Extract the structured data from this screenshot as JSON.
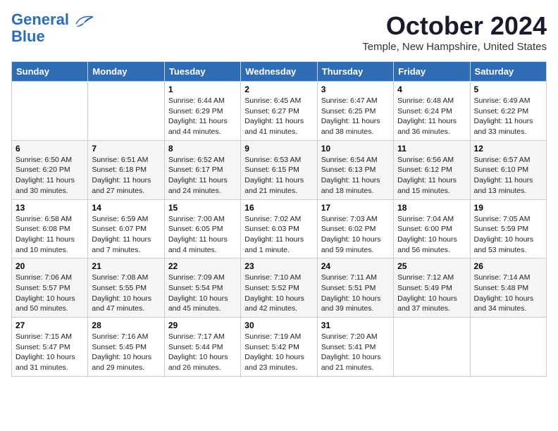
{
  "header": {
    "logo_line1": "General",
    "logo_line2": "Blue",
    "month": "October 2024",
    "location": "Temple, New Hampshire, United States"
  },
  "weekdays": [
    "Sunday",
    "Monday",
    "Tuesday",
    "Wednesday",
    "Thursday",
    "Friday",
    "Saturday"
  ],
  "weeks": [
    [
      {
        "day": "",
        "info": ""
      },
      {
        "day": "",
        "info": ""
      },
      {
        "day": "1",
        "info": "Sunrise: 6:44 AM\nSunset: 6:29 PM\nDaylight: 11 hours and 44 minutes."
      },
      {
        "day": "2",
        "info": "Sunrise: 6:45 AM\nSunset: 6:27 PM\nDaylight: 11 hours and 41 minutes."
      },
      {
        "day": "3",
        "info": "Sunrise: 6:47 AM\nSunset: 6:25 PM\nDaylight: 11 hours and 38 minutes."
      },
      {
        "day": "4",
        "info": "Sunrise: 6:48 AM\nSunset: 6:24 PM\nDaylight: 11 hours and 36 minutes."
      },
      {
        "day": "5",
        "info": "Sunrise: 6:49 AM\nSunset: 6:22 PM\nDaylight: 11 hours and 33 minutes."
      }
    ],
    [
      {
        "day": "6",
        "info": "Sunrise: 6:50 AM\nSunset: 6:20 PM\nDaylight: 11 hours and 30 minutes."
      },
      {
        "day": "7",
        "info": "Sunrise: 6:51 AM\nSunset: 6:18 PM\nDaylight: 11 hours and 27 minutes."
      },
      {
        "day": "8",
        "info": "Sunrise: 6:52 AM\nSunset: 6:17 PM\nDaylight: 11 hours and 24 minutes."
      },
      {
        "day": "9",
        "info": "Sunrise: 6:53 AM\nSunset: 6:15 PM\nDaylight: 11 hours and 21 minutes."
      },
      {
        "day": "10",
        "info": "Sunrise: 6:54 AM\nSunset: 6:13 PM\nDaylight: 11 hours and 18 minutes."
      },
      {
        "day": "11",
        "info": "Sunrise: 6:56 AM\nSunset: 6:12 PM\nDaylight: 11 hours and 15 minutes."
      },
      {
        "day": "12",
        "info": "Sunrise: 6:57 AM\nSunset: 6:10 PM\nDaylight: 11 hours and 13 minutes."
      }
    ],
    [
      {
        "day": "13",
        "info": "Sunrise: 6:58 AM\nSunset: 6:08 PM\nDaylight: 11 hours and 10 minutes."
      },
      {
        "day": "14",
        "info": "Sunrise: 6:59 AM\nSunset: 6:07 PM\nDaylight: 11 hours and 7 minutes."
      },
      {
        "day": "15",
        "info": "Sunrise: 7:00 AM\nSunset: 6:05 PM\nDaylight: 11 hours and 4 minutes."
      },
      {
        "day": "16",
        "info": "Sunrise: 7:02 AM\nSunset: 6:03 PM\nDaylight: 11 hours and 1 minute."
      },
      {
        "day": "17",
        "info": "Sunrise: 7:03 AM\nSunset: 6:02 PM\nDaylight: 10 hours and 59 minutes."
      },
      {
        "day": "18",
        "info": "Sunrise: 7:04 AM\nSunset: 6:00 PM\nDaylight: 10 hours and 56 minutes."
      },
      {
        "day": "19",
        "info": "Sunrise: 7:05 AM\nSunset: 5:59 PM\nDaylight: 10 hours and 53 minutes."
      }
    ],
    [
      {
        "day": "20",
        "info": "Sunrise: 7:06 AM\nSunset: 5:57 PM\nDaylight: 10 hours and 50 minutes."
      },
      {
        "day": "21",
        "info": "Sunrise: 7:08 AM\nSunset: 5:55 PM\nDaylight: 10 hours and 47 minutes."
      },
      {
        "day": "22",
        "info": "Sunrise: 7:09 AM\nSunset: 5:54 PM\nDaylight: 10 hours and 45 minutes."
      },
      {
        "day": "23",
        "info": "Sunrise: 7:10 AM\nSunset: 5:52 PM\nDaylight: 10 hours and 42 minutes."
      },
      {
        "day": "24",
        "info": "Sunrise: 7:11 AM\nSunset: 5:51 PM\nDaylight: 10 hours and 39 minutes."
      },
      {
        "day": "25",
        "info": "Sunrise: 7:12 AM\nSunset: 5:49 PM\nDaylight: 10 hours and 37 minutes."
      },
      {
        "day": "26",
        "info": "Sunrise: 7:14 AM\nSunset: 5:48 PM\nDaylight: 10 hours and 34 minutes."
      }
    ],
    [
      {
        "day": "27",
        "info": "Sunrise: 7:15 AM\nSunset: 5:47 PM\nDaylight: 10 hours and 31 minutes."
      },
      {
        "day": "28",
        "info": "Sunrise: 7:16 AM\nSunset: 5:45 PM\nDaylight: 10 hours and 29 minutes."
      },
      {
        "day": "29",
        "info": "Sunrise: 7:17 AM\nSunset: 5:44 PM\nDaylight: 10 hours and 26 minutes."
      },
      {
        "day": "30",
        "info": "Sunrise: 7:19 AM\nSunset: 5:42 PM\nDaylight: 10 hours and 23 minutes."
      },
      {
        "day": "31",
        "info": "Sunrise: 7:20 AM\nSunset: 5:41 PM\nDaylight: 10 hours and 21 minutes."
      },
      {
        "day": "",
        "info": ""
      },
      {
        "day": "",
        "info": ""
      }
    ]
  ]
}
